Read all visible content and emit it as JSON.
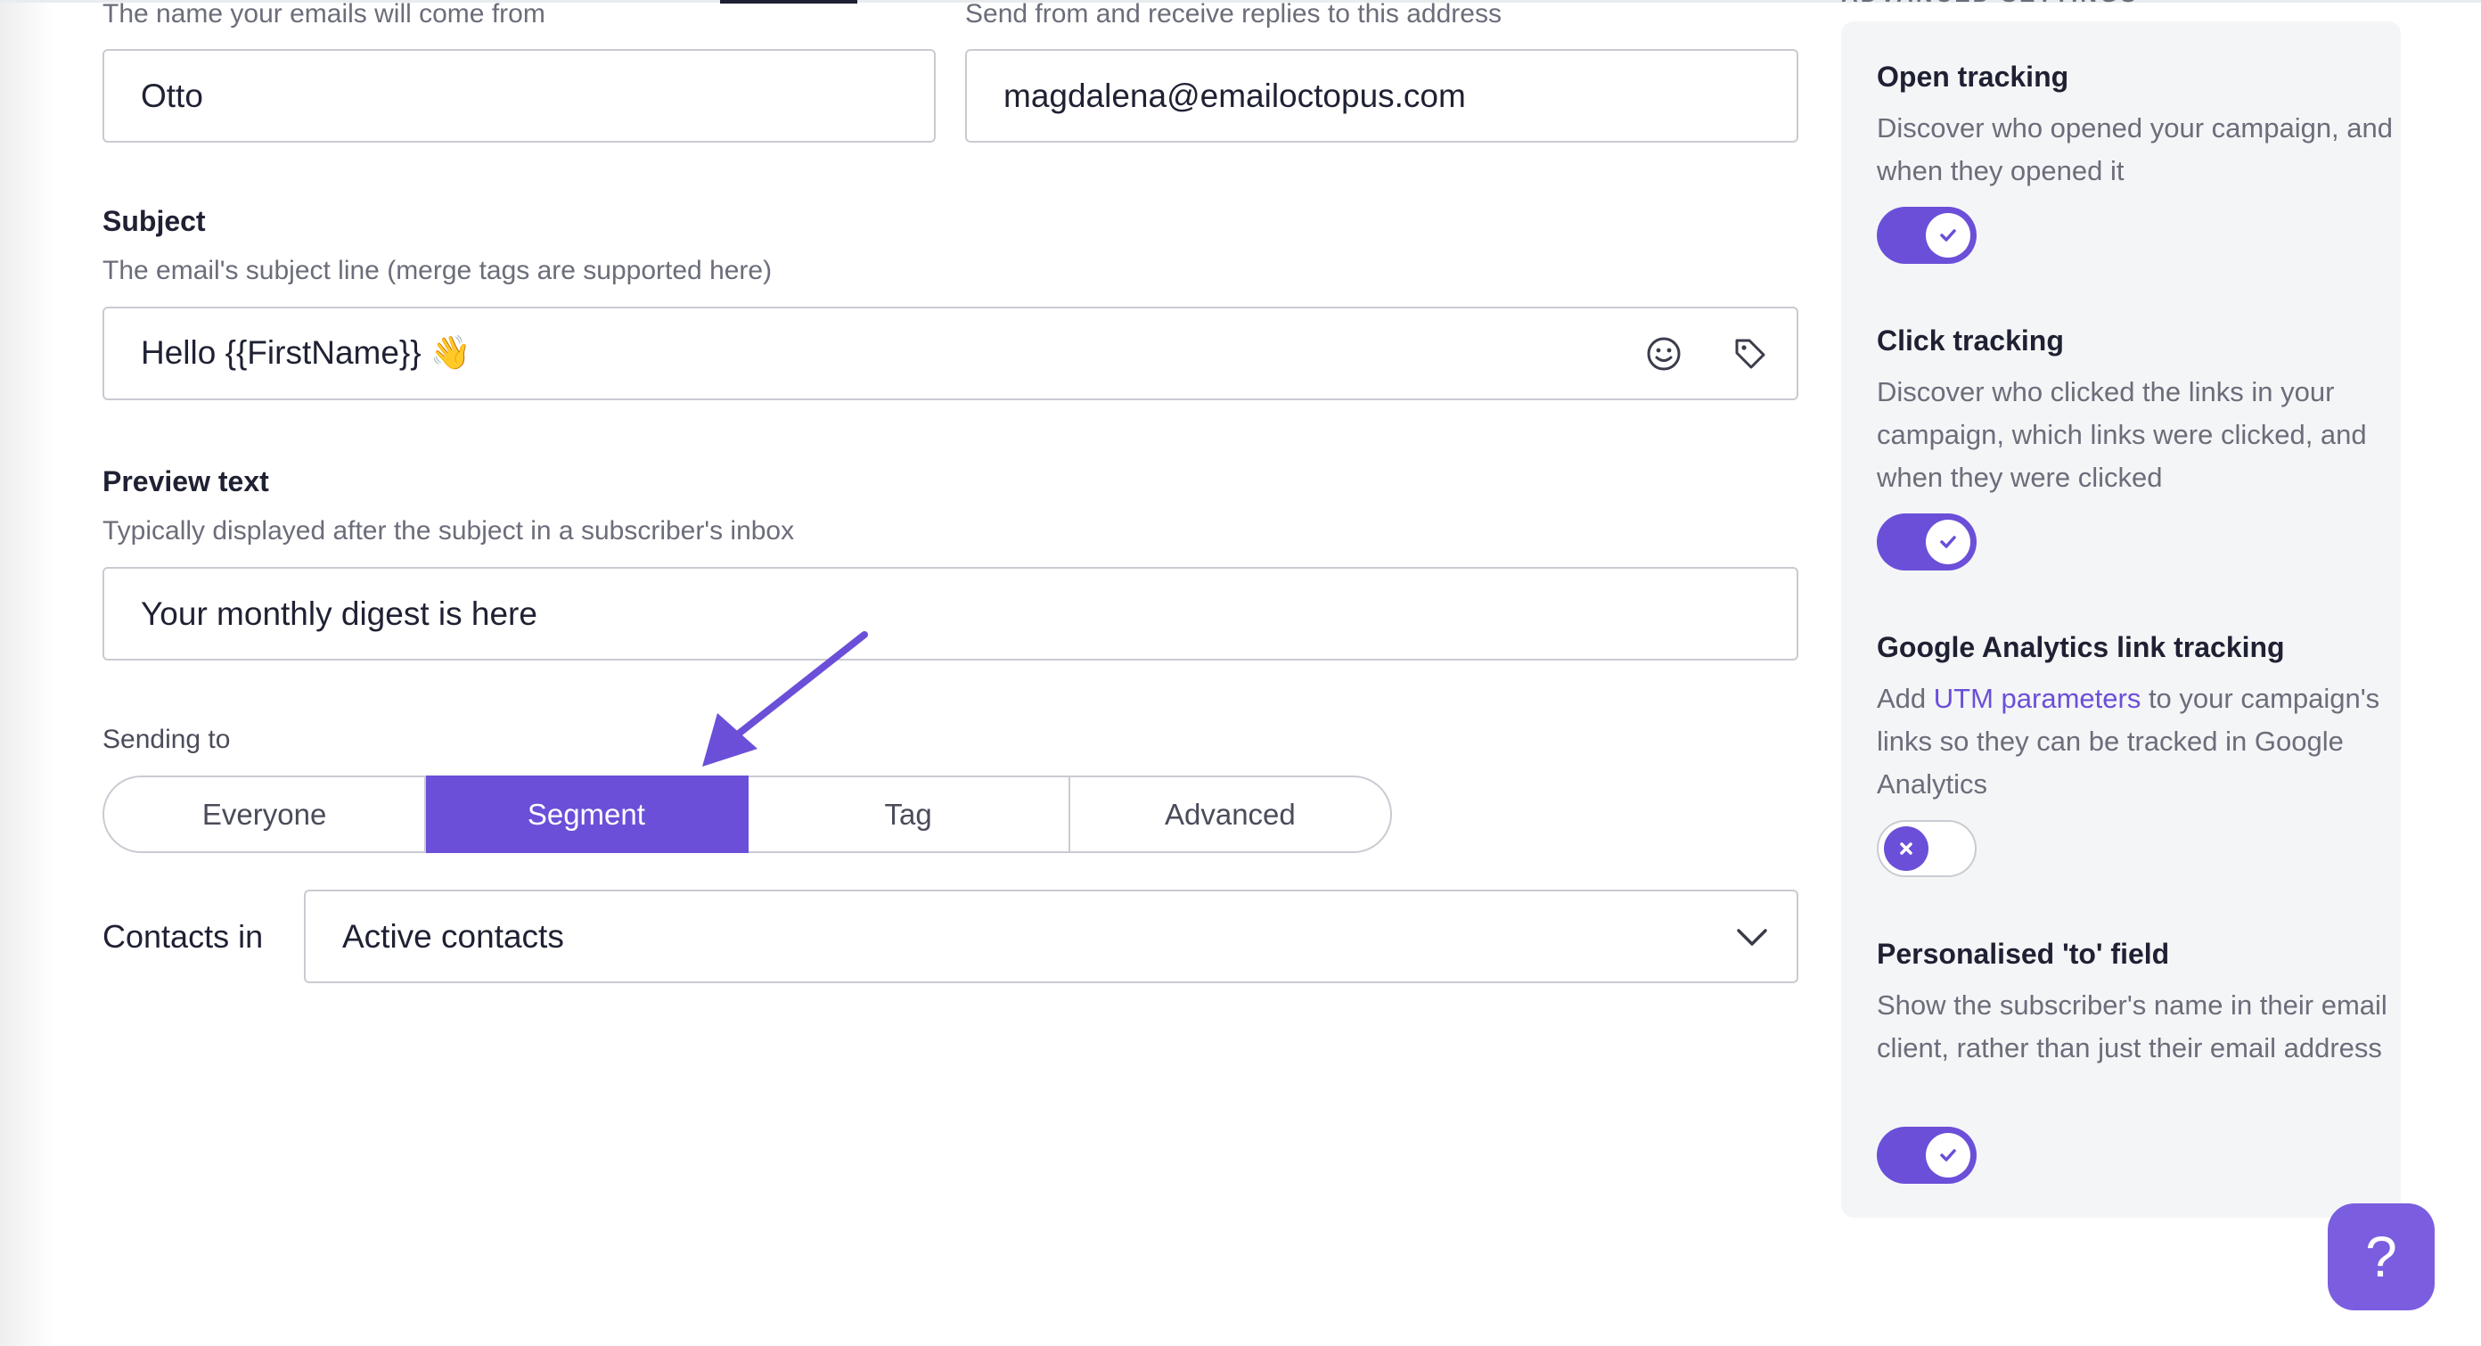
{
  "sender": {
    "name_hint": "The name your emails will come from",
    "name_value": "Otto",
    "email_hint": "Send from and receive replies to this address",
    "email_value": "magdalena@emailoctopus.com"
  },
  "subject": {
    "label": "Subject",
    "hint": "The email's subject line (merge tags are supported here)",
    "value": "Hello {{FirstName}} 👋",
    "emoji_icon": "smiley-icon",
    "tag_icon": "tag-icon"
  },
  "preview": {
    "label": "Preview text",
    "hint": "Typically displayed after the subject in a subscriber's inbox",
    "value": "Your monthly digest is here"
  },
  "sending_to": {
    "label": "Sending to",
    "options": [
      "Everyone",
      "Segment",
      "Tag",
      "Advanced"
    ],
    "selected": "Segment"
  },
  "contacts": {
    "label": "Contacts in",
    "value": "Active contacts"
  },
  "settings": {
    "heading": "ADVANCED SETTINGS",
    "items": [
      {
        "title": "Open tracking",
        "desc": "Discover who opened your campaign, and when they opened it",
        "enabled": true
      },
      {
        "title": "Click tracking",
        "desc": "Discover who clicked the links in your campaign, which links were clicked, and when they were clicked",
        "enabled": true
      },
      {
        "title": "Google Analytics link tracking",
        "desc_pre": "Add ",
        "desc_link": "UTM parameters",
        "desc_post": " to your campaign's links so they can be tracked in Google Analytics",
        "enabled": false
      },
      {
        "title": "Personalised 'to' field",
        "desc": "Show the subscriber's name in their email client, rather than just their email address",
        "enabled": true
      }
    ]
  },
  "help": {
    "label": "?"
  },
  "colors": {
    "accent": "#6b4fd8",
    "help_button": "#7b5ee0",
    "panel_bg": "#f4f5f7"
  }
}
